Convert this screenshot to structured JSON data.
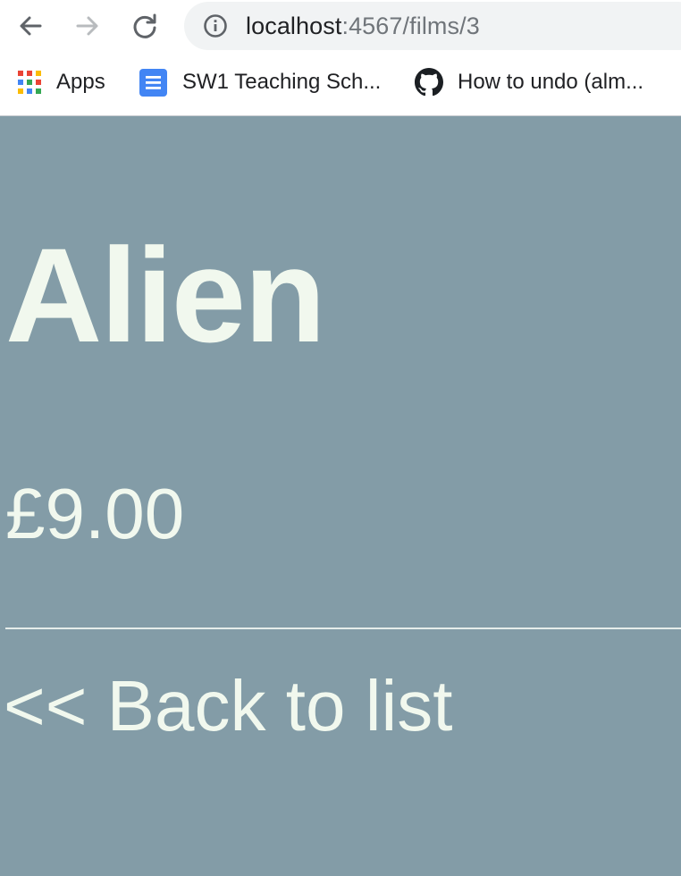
{
  "browser": {
    "url_host": "localhost",
    "url_path": ":4567/films/3",
    "bookmarks": [
      {
        "label": "Apps",
        "icon": "apps-grid-icon"
      },
      {
        "label": "SW1 Teaching Sch...",
        "icon": "google-docs-icon"
      },
      {
        "label": "How to undo (alm...",
        "icon": "github-icon"
      }
    ]
  },
  "film": {
    "title": "Alien",
    "price": "£9.00"
  },
  "nav": {
    "back_link": "<< Back to list"
  },
  "colors": {
    "page_background": "#839ca7",
    "text": "#f1f8ee",
    "docs_blue": "#4285f4"
  }
}
